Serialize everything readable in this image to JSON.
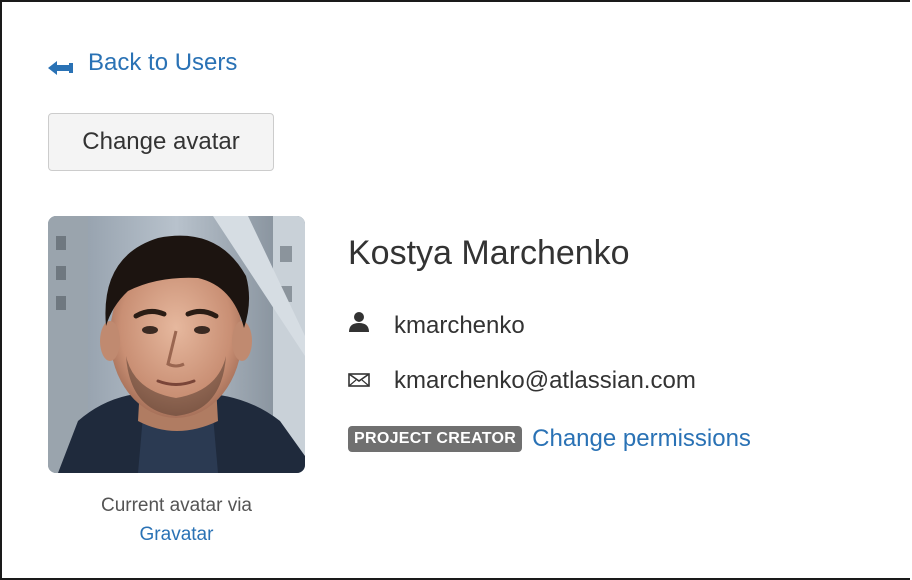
{
  "nav": {
    "back_label": "Back to Users"
  },
  "actions": {
    "change_avatar_label": "Change avatar"
  },
  "avatar": {
    "caption": "Current avatar via",
    "provider_link": "Gravatar"
  },
  "user": {
    "full_name": "Kostya Marchenko",
    "username": "kmarchenko",
    "email": "kmarchenko@atlassian.com",
    "role_badge": "PROJECT CREATOR",
    "change_permissions_label": "Change permissions"
  },
  "icons": {
    "back": "arrow-left-icon",
    "username": "user-icon",
    "email": "envelope-icon"
  },
  "colors": {
    "link": "#2a72b5",
    "badge_bg": "#707070",
    "button_bg": "#f4f4f4",
    "text": "#333333"
  }
}
